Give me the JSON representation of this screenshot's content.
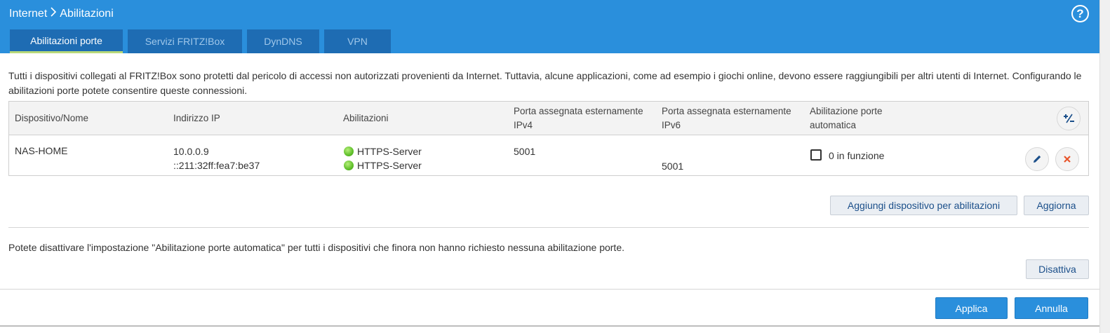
{
  "breadcrumb": {
    "parent": "Internet",
    "current": "Abilitazioni"
  },
  "help_label": "?",
  "tabs": [
    {
      "label": "Abilitazioni porte",
      "active": true
    },
    {
      "label": "Servizi FRITZ!Box",
      "active": false
    },
    {
      "label": "DynDNS",
      "active": false
    },
    {
      "label": "VPN",
      "active": false
    }
  ],
  "intro_text": "Tutti i dispositivi collegati al FRITZ!Box sono protetti dal pericolo di accessi non autorizzati provenienti da Internet. Tuttavia, alcune applicazioni, come ad esempio i giochi online, devono essere raggiungibili per altri utenti di Internet. Configurando le abilitazioni porte potete consentire queste connessioni.",
  "table": {
    "headers": {
      "device": "Dispositivo/Nome",
      "ip": "Indirizzo IP",
      "shares": "Abilitazioni",
      "port_ipv4": "Porta assegnata esternamente IPv4",
      "port_ipv6": "Porta assegnata esternamente IPv6",
      "auto": "Abilitazione porte automatica"
    },
    "rows": [
      {
        "device": "NAS-HOME",
        "ipv4": "10.0.0.9",
        "ipv6": "::211:32ff:fea7:be37",
        "share1": "HTTPS-Server",
        "share2": "HTTPS-Server",
        "port_ipv4": "5001",
        "port_ipv6": "5001",
        "auto_label": "0 in funzione",
        "auto_checked": false
      }
    ]
  },
  "buttons": {
    "add_device": "Aggiungi dispositivo per abilitazioni",
    "refresh": "Aggiorna",
    "disable": "Disattiva",
    "apply": "Applica",
    "cancel": "Annulla"
  },
  "disable_text": "Potete disattivare l'impostazione \"Abilitazione porte automatica\" per tutti i dispositivi che finora non hanno richiesto nessuna abilitazione porte.",
  "colors": {
    "header_bg": "#2a8fdc",
    "tab_bg": "#1e6cb3",
    "tab_active_underline": "#b8d97a",
    "status_green": "#5fbf2a",
    "delete_red": "#e8552b",
    "edit_blue": "#1b4f8a"
  },
  "icons": {
    "help": "help-icon",
    "add_remove": "plus-minus-icon",
    "edit": "pencil-icon",
    "delete": "close-icon",
    "status": "green-status-dot"
  }
}
